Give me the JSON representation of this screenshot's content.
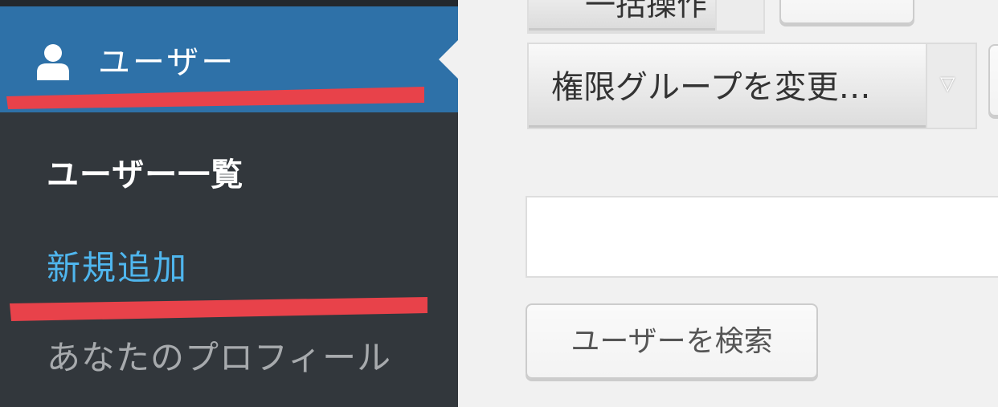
{
  "sidebar": {
    "users_menu": {
      "icon": "user-icon",
      "label": "ユーザー",
      "accent_color": "#2e71a8"
    },
    "submenu": [
      {
        "label": "ユーザー一覧",
        "state": "current"
      },
      {
        "label": "新規追加",
        "state": "hover",
        "color": "#4fb6ee"
      },
      {
        "label": "あなたのプロフィール",
        "state": "normal"
      }
    ],
    "background_color": "#32373c"
  },
  "main": {
    "bulk_action_select": {
      "selected": "一括操作"
    },
    "role_change_select": {
      "selected": "権限グループを変更…",
      "arrow_icon": "chevron-down-icon"
    },
    "search": {
      "input_value": "",
      "button_label": "ユーザーを検索"
    }
  },
  "annotation": {
    "color": "#e8424a"
  }
}
